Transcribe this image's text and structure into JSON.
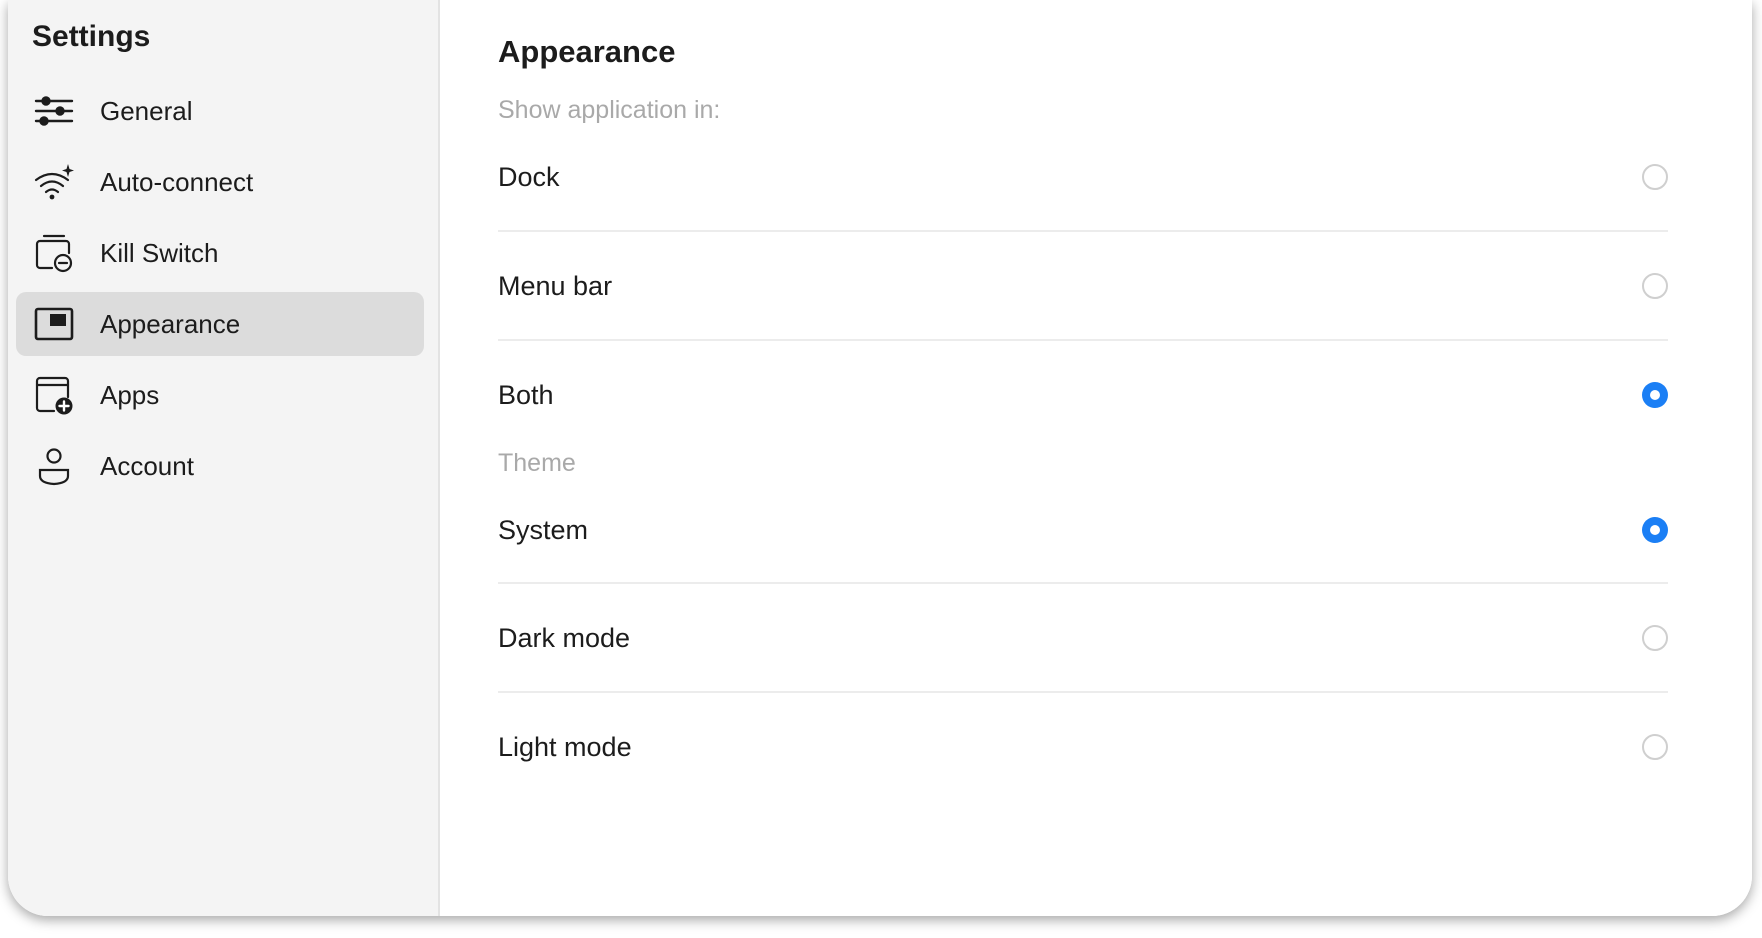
{
  "sidebar": {
    "title": "Settings",
    "items": [
      {
        "label": "General",
        "icon": "sliders-icon",
        "active": false
      },
      {
        "label": "Auto-connect",
        "icon": "wifi-sparkle-icon",
        "active": false
      },
      {
        "label": "Kill Switch",
        "icon": "kill-switch-icon",
        "active": false
      },
      {
        "label": "Appearance",
        "icon": "window-icon",
        "active": true
      },
      {
        "label": "Apps",
        "icon": "apps-add-icon",
        "active": false
      },
      {
        "label": "Account",
        "icon": "person-icon",
        "active": false
      }
    ]
  },
  "main": {
    "title": "Appearance",
    "show_in": {
      "label": "Show application in:",
      "options": [
        {
          "label": "Dock",
          "selected": false
        },
        {
          "label": "Menu bar",
          "selected": false
        },
        {
          "label": "Both",
          "selected": true
        }
      ]
    },
    "theme": {
      "label": "Theme",
      "options": [
        {
          "label": "System",
          "selected": true
        },
        {
          "label": "Dark mode",
          "selected": false
        },
        {
          "label": "Light mode",
          "selected": false
        }
      ]
    }
  },
  "colors": {
    "accent": "#1b7ff5",
    "sidebar_bg": "#f4f4f4",
    "active_item_bg": "#dcdcdc",
    "muted_text": "#a9a9a9"
  }
}
